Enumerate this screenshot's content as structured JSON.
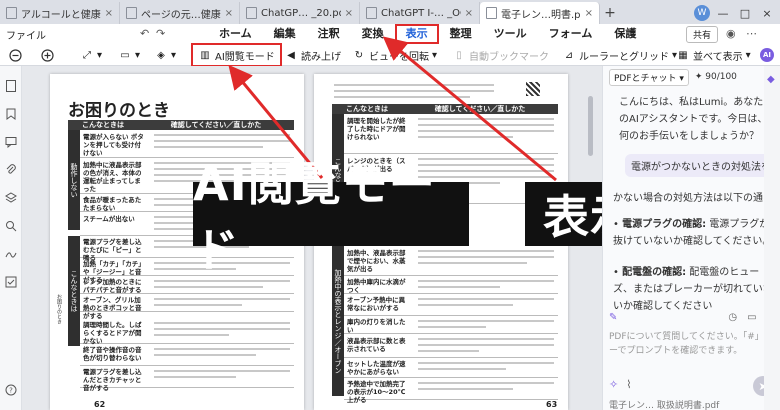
{
  "tabs": [
    {
      "label": "アルコールと健康.pdf",
      "close": "×",
      "active": false
    },
    {
      "label": "ページの元…健康.pdf *",
      "close": "×",
      "active": false
    },
    {
      "label": "ChatGP… _20.pdf",
      "close": "×",
      "active": false
    },
    {
      "label": "ChatGPT I-… _OCR.pdf",
      "close": "×",
      "active": false
    },
    {
      "label": "電子レン…明書.pdf",
      "close": "×",
      "active": true
    }
  ],
  "new_tab": "+",
  "window": {
    "avatar": "W",
    "minimize": "—",
    "maximize": "□",
    "close": "×"
  },
  "menu": {
    "file": "ファイル",
    "items": [
      "ホーム",
      "編集",
      "注釈",
      "変換",
      "表示",
      "整理",
      "ツール",
      "フォーム",
      "保護"
    ],
    "active": "表示",
    "share": "共有"
  },
  "toolbar": {
    "ai_reading_mode": "AI閲覧モード",
    "read_aloud": "読み上げ",
    "rotate_view": "ビューを回転",
    "auto_bookmark": "自動ブックマーク",
    "ruler_grid": "ルーラーとグリッド",
    "side_by_side": "並べて表示"
  },
  "left_page": {
    "number": "62",
    "title": "お困りのとき",
    "header_cols": [
      "こんなときは",
      "確認してください／直しかた"
    ],
    "categories": [
      "動作しない",
      "こんなときは"
    ],
    "rows": [
      "電源が入らない\nボタンを押しても受け付けない",
      "加熱中に液晶表示部の色が消え、本体の運転が止まってしまった",
      "食品が暖まったあたたまらない",
      "スチームが出ない",
      "電源プラグを差し込むたびに「ピー」と鳴る",
      "加熱「カチ」「カチ」や「ジージー」と音がする",
      "レンジ加熱のときにパチパチと音がする",
      "オーブン、グリル加熱のときボコッと音がする",
      "調理時間した。しばらくするとドアが開かない",
      "終了音や操作音の音色が切り替わらない",
      "電源プラグを差し込んだときカチャッと音がする"
    ],
    "side_text": "お困りのとき"
  },
  "right_page": {
    "number": "63",
    "header_cols": [
      "こんなときは",
      "確認してください／直しかた"
    ],
    "categories": [
      "こんなときは",
      "加熱中の表示とレンジ／オーブン"
    ],
    "rows": [
      "調理を開始したが終了した時にドアが開けられない",
      "レンジのときを（スパーク）が出る",
      "加熱中、液晶表示部で煙やにおい、水蒸気が出る",
      "加熱中庫内に水滴がつく",
      "オーブン予熱中に異常なにおいがする",
      "庫内の灯りを消したい",
      "液晶表示部に数と表示されている",
      "セットした温度が速やかにあがらない",
      "予熱途中で加熱完了の表示が10〜20℃上がる"
    ]
  },
  "overlay": {
    "caption_ai": "AI閲覧モード",
    "caption_view": "表示"
  },
  "chat": {
    "mode": "PDFとチャット",
    "credits": "90/100",
    "greeting": "こんにちは、私はLumi。あなたのAIアシスタントです。今日は、何のお手伝いをしましょうか？",
    "user_message": "電源がつかないときの対処法を教えて",
    "reply_intro": "かない場合の対処方法は以下の通り",
    "reply_1_label": "電源プラグの確認:",
    "reply_1_text": "電源プラグが抜けていないか確認してください。",
    "reply_2_label": "配電盤の確認:",
    "reply_2_text": "配電盤のヒューズ、またはブレーカーが切れていないか確認してください",
    "input_placeholder": "PDFについて質問してください。「#」キーでプロンプトを確認できます。",
    "footer": "電子レン… 取扱説明書.pdf"
  },
  "colors": {
    "accent": "#1e5fd8",
    "highlight": "#e02a2a",
    "caption_bg": "#111111"
  }
}
